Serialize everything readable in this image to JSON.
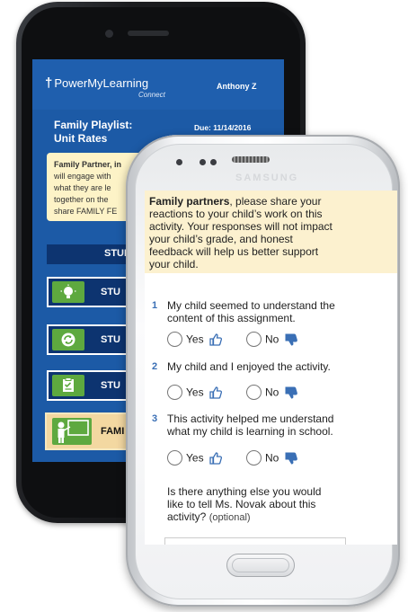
{
  "back_phone": {
    "brand": "PowerMyLearning",
    "brand_sub": "Connect",
    "user": "Anthony Z",
    "playlist_title_line1": "Family Playlist:",
    "playlist_title_line2": "Unit Rates",
    "due": "Due: 11/14/2016",
    "note_lines": [
      "Family Partner, in",
      "will engage with",
      "what they are le",
      "together on the",
      "share FAMILY FE"
    ],
    "student_header": "STUDEN",
    "activities": [
      {
        "label": "STU",
        "icon": "lightbulb-icon"
      },
      {
        "label": "STU",
        "icon": "refresh-icon"
      },
      {
        "label": "STU",
        "icon": "checklist-icon"
      }
    ],
    "family_label": "FAMI",
    "family_icon": "family-teacher-icon"
  },
  "front_phone": {
    "brand": "SAMSUNG",
    "intro_bold": "Family partners",
    "intro_lines": [
      ", please share your",
      "reactions to your child’s work on this",
      "activity. Your responses will not impact",
      "your child’s grade, and honest",
      "feedback will help us better support",
      "your child."
    ],
    "questions": [
      {
        "num": "1",
        "lines": [
          "My child seemed to understand the",
          "content of this assignment."
        ],
        "yes": "Yes",
        "no": "No"
      },
      {
        "num": "2",
        "lines": [
          "My child and I enjoyed the activity."
        ],
        "yes": "Yes",
        "no": "No"
      },
      {
        "num": "3",
        "lines": [
          "This activity helped me understand",
          "what my child is learning in school."
        ],
        "yes": "Yes",
        "no": "No"
      }
    ],
    "open_question_lines": [
      "Is there anything else you would",
      "like to tell Ms. Novak about this",
      "activity?"
    ],
    "optional": "(optional)"
  },
  "colors": {
    "brand_blue": "#1f5fae",
    "dark_navy": "#0d3470",
    "green": "#5ea93f",
    "note_yellow": "#fdf3c7",
    "question_blue": "#3a6fb5"
  }
}
